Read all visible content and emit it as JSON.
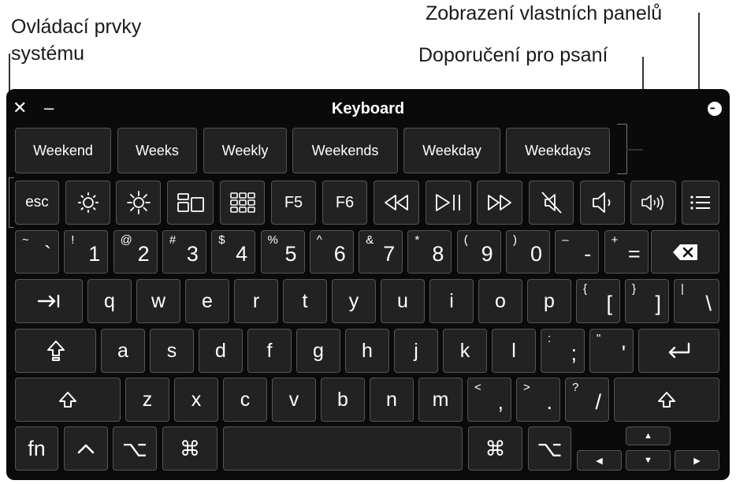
{
  "callouts": {
    "system_controls_line1": "Ovládací prvky",
    "system_controls_line2": "systému",
    "custom_panels": "Zobrazení vlastních panelů",
    "typing_suggestions": "Doporučení pro psaní"
  },
  "window": {
    "title": "Keyboard",
    "close": "✕",
    "minimize": "–",
    "more": "•••"
  },
  "suggestions": [
    "Weekend",
    "Weeks",
    "Weekly",
    "Weekends",
    "Weekday",
    "Weekdays"
  ],
  "function_row": {
    "esc": "esc",
    "f5": "F5",
    "f6": "F6",
    "icons": [
      "brightness-down-icon",
      "brightness-up-icon",
      "mission-control-icon",
      "launchpad-icon",
      "rewind-icon",
      "play-pause-icon",
      "fast-forward-icon",
      "mute-icon",
      "volume-down-icon",
      "volume-up-icon",
      "panels-list-icon"
    ]
  },
  "number_row": [
    {
      "up": "~",
      "main": "`"
    },
    {
      "up": "!",
      "main": "1"
    },
    {
      "up": "@",
      "main": "2"
    },
    {
      "up": "#",
      "main": "3"
    },
    {
      "up": "$",
      "main": "4"
    },
    {
      "up": "%",
      "main": "5"
    },
    {
      "up": "^",
      "main": "6"
    },
    {
      "up": "&",
      "main": "7"
    },
    {
      "up": "*",
      "main": "8"
    },
    {
      "up": "(",
      "main": "9"
    },
    {
      "up": ")",
      "main": "0"
    },
    {
      "up": "–",
      "main": "-"
    },
    {
      "up": "+",
      "main": "="
    }
  ],
  "qwerty_row": [
    "q",
    "w",
    "e",
    "r",
    "t",
    "y",
    "u",
    "i",
    "o",
    "p"
  ],
  "qwerty_extra": [
    {
      "up": "{",
      "main": "["
    },
    {
      "up": "}",
      "main": "]"
    },
    {
      "up": "|",
      "main": "\\"
    }
  ],
  "home_row": [
    "a",
    "s",
    "d",
    "f",
    "g",
    "h",
    "j",
    "k",
    "l"
  ],
  "home_extra": [
    {
      "up": ":",
      "main": ";"
    },
    {
      "up": "\"",
      "main": "'"
    }
  ],
  "bottom_letter_row": [
    "z",
    "x",
    "c",
    "v",
    "b",
    "n",
    "m"
  ],
  "bottom_extra": [
    {
      "up": "<",
      "main": ","
    },
    {
      "up": ">",
      "main": "."
    },
    {
      "up": "?",
      "main": "/"
    }
  ],
  "modifiers": {
    "tab": "⇥",
    "caps": "⇪",
    "shift": "⇧",
    "delete": "⌫",
    "return": "↩",
    "fn": "fn",
    "control": "^",
    "option": "⌥",
    "command": "⌘"
  },
  "arrows": {
    "up": "▲",
    "left": "◀",
    "down": "▼",
    "right": "▶"
  }
}
